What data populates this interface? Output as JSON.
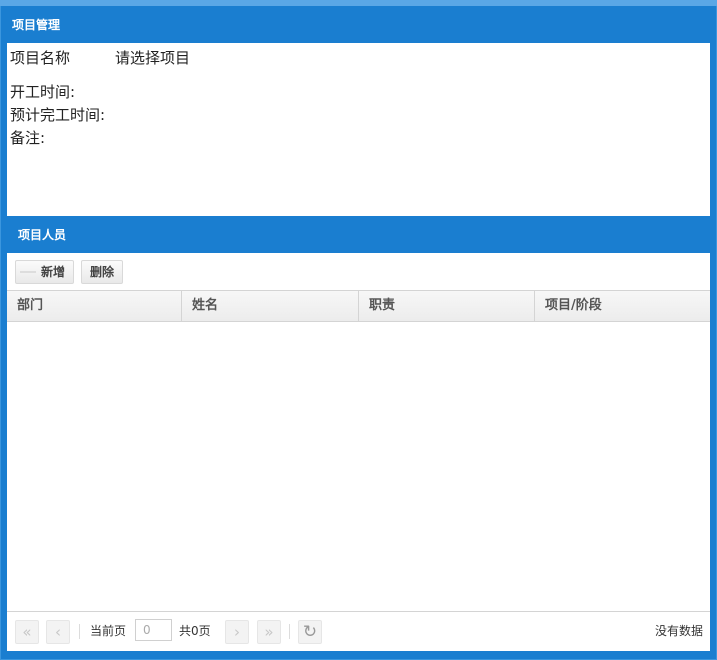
{
  "project_panel": {
    "title": "项目管理",
    "name_label": "项目名称",
    "name_value": "请选择项目",
    "start_label": "开工时间:",
    "finish_label": "预计完工时间:",
    "remark_label": "备注:"
  },
  "people_panel": {
    "title": "项目人员",
    "toolbar": {
      "add_label": "新增",
      "delete_label": "删除"
    },
    "columns": [
      "部门",
      "姓名",
      "职责",
      "项目/阶段"
    ],
    "pager": {
      "first_icon": "first-page-icon",
      "prev_icon": "prev-page-icon",
      "next_icon": "next-page-icon",
      "last_icon": "last-page-icon",
      "refresh_icon": "refresh-icon",
      "current_page_label": "当前页",
      "current_page_value": "0",
      "total_pages_label": "共0页",
      "empty_text": "没有数据"
    }
  },
  "colors": {
    "header_blue": "#1a7ed0",
    "panel_bg": "#ffffff"
  }
}
